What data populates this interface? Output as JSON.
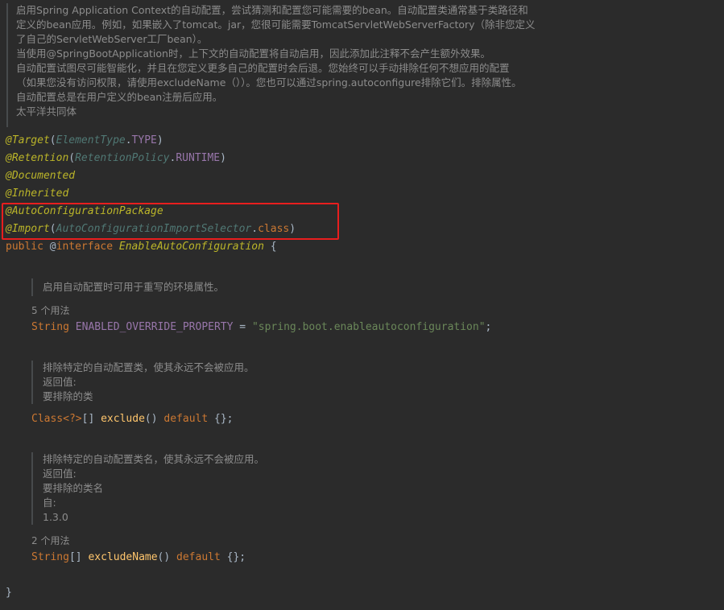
{
  "doc_lines": [
    "启用Spring Application Context的自动配置，尝试猜测和配置您可能需要的bean。自动配置类通常基于类路径和",
    "定义的bean应用。例如，如果嵌入了tomcat。jar，您很可能需要TomcatServletWebServerFactory（除非您定义",
    "了自己的ServletWebServer工厂bean）。",
    "当使用@SpringBootApplication时，上下文的自动配置将自动启用，因此添加此注释不会产生额外效果。",
    "自动配置试图尽可能智能化，并且在您定义更多自己的配置时会后退。您始终可以手动排除任何不想应用的配置",
    "（如果您没有访问权限，请使用excludeName（））。您也可以通过spring.autoconfigure排除它们。排除属性。",
    "自动配置总是在用户定义的bean注册后应用。",
    "太平洋共同体"
  ],
  "code": {
    "target_ann": "@Target",
    "target_type": "ElementType",
    "target_value": "TYPE",
    "retention_ann": "@Retention",
    "retention_type": "RetentionPolicy",
    "retention_value": "RUNTIME",
    "documented_ann": "@Documented",
    "inherited_ann": "@Inherited",
    "autopkg_ann": "@AutoConfigurationPackage",
    "import_ann": "@Import",
    "import_class": "AutoConfigurationImportSelector",
    "import_kw": "class",
    "public_kw": "public",
    "at_sign": "@",
    "interface_kw": "interface",
    "interface_name": "EnableAutoConfiguration",
    "open_brace": "{",
    "close_brace": "}"
  },
  "member1": {
    "doc": "启用自动配置时可用于重写的环境属性。",
    "usage": "5 个用法",
    "type": "String",
    "name": "ENABLED_OVERRIDE_PROPERTY",
    "eq": " = ",
    "value": "\"spring.boot.enableautoconfiguration\"",
    "end": ";"
  },
  "member2": {
    "doc_lines": [
      "排除特定的自动配置类，使其永远不会被应用。",
      "返回值:",
      "要排除的类"
    ],
    "type": "Class",
    "generic": "<?>",
    "arr": "[] ",
    "name": "exclude",
    "parens": "() ",
    "default_kw": "default",
    "tail": " {};"
  },
  "member3": {
    "doc_lines": [
      "排除特定的自动配置类名，使其永远不会被应用。",
      "返回值:",
      "要排除的类名",
      "自:",
      "1.3.0"
    ],
    "usage": "2 个用法",
    "type": "String",
    "arr": "[] ",
    "name": "excludeName",
    "parens": "() ",
    "default_kw": "default",
    "tail": " {};"
  }
}
